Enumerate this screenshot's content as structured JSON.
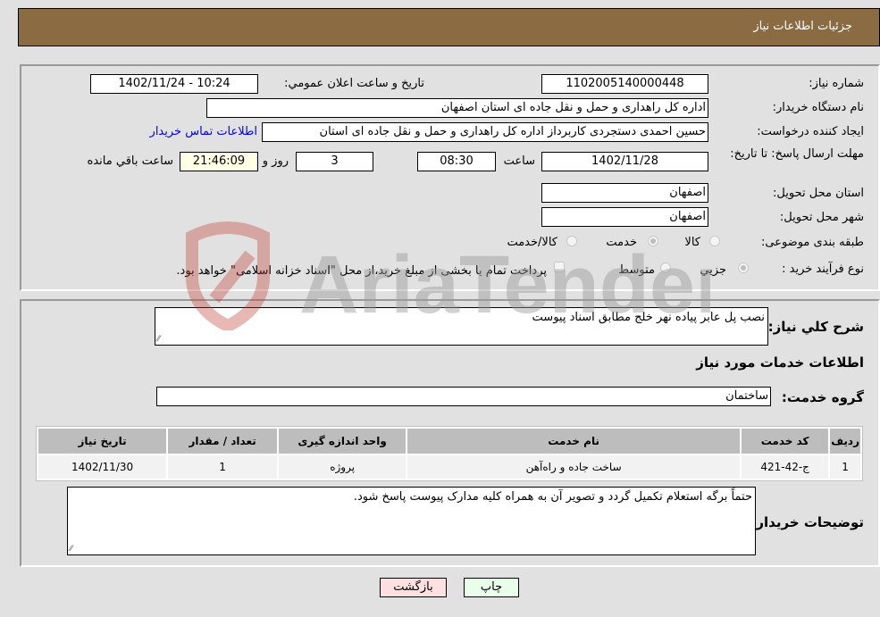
{
  "header": {
    "title": "جزئیات اطلاعات نیاز"
  },
  "form": {
    "need_number": {
      "label": "شماره نیاز:",
      "value": "1102005140000448"
    },
    "announce_datetime": {
      "label": "تاریخ و ساعت اعلان عمومي:",
      "value": "1402/11/24 - 10:24"
    },
    "buyer_org": {
      "label": "نام دستگاه خریدار:",
      "value": "اداره کل راهداری و حمل و نقل جاده ای استان اصفهان"
    },
    "requester": {
      "label": "ایجاد کننده درخواست:",
      "value": "حسین احمدی دستجردی کاربرداز اداره کل راهداری و حمل و نقل جاده ای استان"
    },
    "buyer_contact_link": "اطلاعات تماس خریدار",
    "deadline": {
      "label": "مهلت ارسال پاسخ: تا تاریخ:",
      "date": "1402/11/28",
      "time_label": "ساعت",
      "time": "08:30",
      "days": "3",
      "days_label": "روز و",
      "remaining": "21:46:09",
      "remaining_label": "ساعت باقي مانده"
    },
    "delivery_province": {
      "label": "استان محل تحویل:",
      "value": "اصفهان"
    },
    "delivery_city": {
      "label": "شهر محل تحویل:",
      "value": "اصفهان"
    },
    "category": {
      "label": "طبقه بندی موضوعی:",
      "options": [
        {
          "label": "کالا",
          "selected": false
        },
        {
          "label": "خدمت",
          "selected": true
        },
        {
          "label": "کالا/خدمت",
          "selected": false
        }
      ]
    },
    "purchase_process": {
      "label": "نوع فرآیند خرید :",
      "options": [
        {
          "label": "جزيي",
          "selected": true
        },
        {
          "label": "متوسط",
          "selected": false
        }
      ],
      "treasury_note": "پرداخت تمام یا بخشی از مبلغ خرید،از محل \"اسناد خزانه اسلامی\" خواهد بود."
    }
  },
  "details": {
    "general_description_label": "شرح كلي نياز:",
    "general_description": "نصب پل عابر پیاده نهر خلج مطابق اسناد پیوست",
    "services_info_title": "اطلاعات خدمات مورد نیاز",
    "service_group_label": "گروه خدمت:",
    "service_group": "ساختمان",
    "table": {
      "headers": [
        "ردیف",
        "کد خدمت",
        "نام خدمت",
        "واحد اندازه گیری",
        "تعداد / مقدار",
        "تاریخ نیاز"
      ],
      "rows": [
        [
          "1",
          "ج-42-421",
          "ساخت جاده و راه‌آهن",
          "پروژه",
          "1",
          "1402/11/30"
        ]
      ]
    },
    "buyer_notes_label": "توضیحات خریدار:",
    "buyer_notes": "حتماً برگه استعلام تکمیل گردد و تصویر آن به همراه کلیه مدارک پیوست پاسخ شود."
  },
  "buttons": {
    "print": "چاپ",
    "back": "بازگشت"
  },
  "watermark": {
    "text": "AriaTender.neT"
  }
}
